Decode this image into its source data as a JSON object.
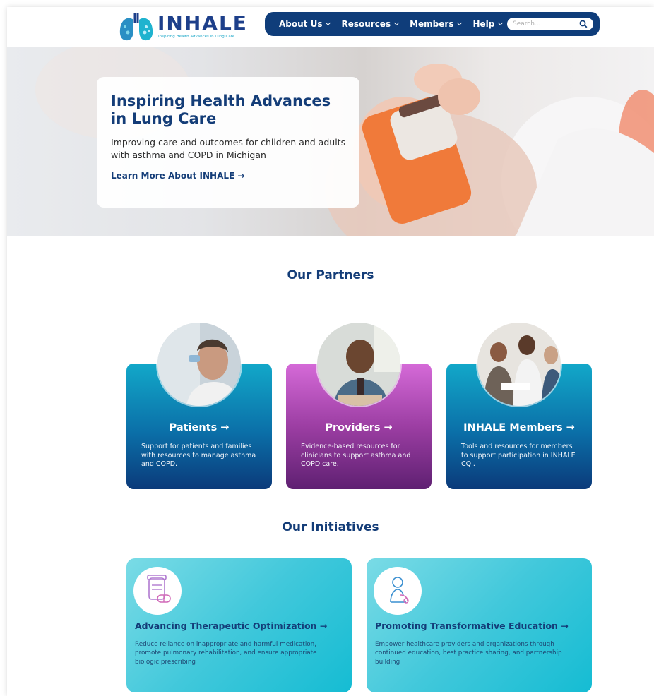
{
  "brand": {
    "name": "INHALE",
    "tagline": "Inspiring Health Advances in Lung Care",
    "colors": {
      "navy": "#0f3d7a",
      "teal": "#15bcd3",
      "purple": "#9c3ea3"
    }
  },
  "nav": {
    "items": [
      {
        "label": "About Us"
      },
      {
        "label": "Resources"
      },
      {
        "label": "Members"
      },
      {
        "label": "Help"
      }
    ],
    "search": {
      "placeholder": "Search..."
    }
  },
  "hero": {
    "title": "Inspiring Health Advances in Lung Care",
    "subtitle": "Improving care and outcomes for children and adults with asthma and COPD in Michigan",
    "link": "Learn More About INHALE →"
  },
  "partners": {
    "heading": "Our Partners",
    "cards": [
      {
        "title": "Patients →",
        "desc": "Support for patients and families with resources to manage asthma and COPD."
      },
      {
        "title": "Providers →",
        "desc": "Evidence-based resources for clinicians to support asthma and COPD care."
      },
      {
        "title": "INHALE Members →",
        "desc": "Tools and resources for members to support participation in INHALE CQI."
      }
    ]
  },
  "initiatives": {
    "heading": "Our Initiatives",
    "cards": [
      {
        "title": "Advancing Therapeutic Optimization →",
        "desc": "Reduce reliance on inappropriate and harmful medication, promote pulmonary rehabilitation, and ensure appropriate biologic prescribing",
        "icon": "medication-icon"
      },
      {
        "title": "Promoting Transformative Education →",
        "desc": "Empower healthcare providers and organizations through continued education, best practice sharing, and partnership building",
        "icon": "education-icon"
      }
    ]
  }
}
